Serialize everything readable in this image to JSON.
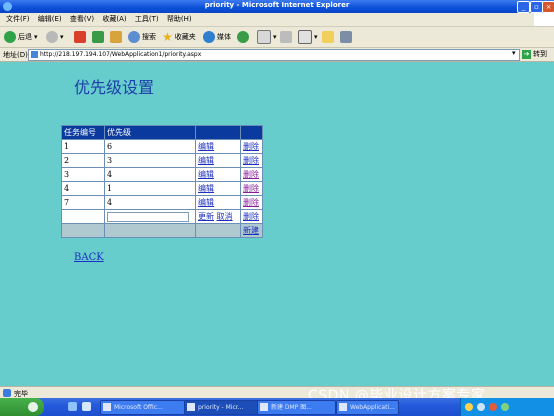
{
  "window": {
    "title": "priority - Microsoft Internet Explorer"
  },
  "menu": [
    "文件(F)",
    "编辑(E)",
    "查看(V)",
    "收藏(A)",
    "工具(T)",
    "帮助(H)"
  ],
  "toolbar": {
    "back": "后退",
    "search": "搜索",
    "favorites": "收藏夹",
    "media": "媒体"
  },
  "address": {
    "label": "地址(D)",
    "url": "http://218.197.194.107/WebApplication1/priority.aspx",
    "go": "转到"
  },
  "page": {
    "heading": "优先级设置",
    "columns": [
      "任务编号",
      "优先级",
      "",
      ""
    ],
    "rows": [
      {
        "id": "1",
        "priority": "6",
        "edit": "编辑",
        "delete": "删除"
      },
      {
        "id": "2",
        "priority": "3",
        "edit": "编辑",
        "delete": "删除"
      },
      {
        "id": "3",
        "priority": "4",
        "edit": "编辑",
        "delete": "删除"
      },
      {
        "id": "4",
        "priority": "1",
        "edit": "编辑",
        "delete": "删除"
      },
      {
        "id": "7",
        "priority": "4",
        "edit": "编辑",
        "delete": "删除"
      }
    ],
    "edit_row": {
      "id": "",
      "value": "",
      "update": "更新",
      "cancel": "取消",
      "delete": "删除"
    },
    "footer": {
      "new": "新建"
    },
    "back_link": "BACK"
  },
  "status": {
    "text": "完毕"
  },
  "watermark": "CSDN @毕业设计方案专家",
  "taskbar": {
    "items": [
      "Microsoft Offic...",
      "priority - Micr...",
      "新建 DMP 图...",
      "WebApplicati..."
    ]
  }
}
